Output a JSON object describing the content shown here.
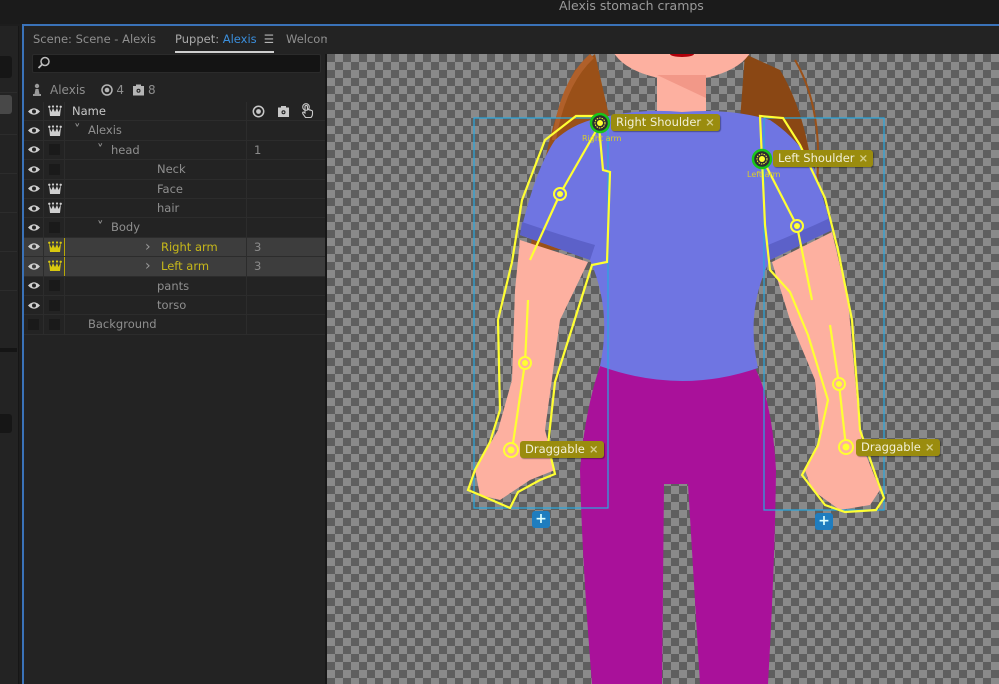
{
  "window": {
    "title": "Alexis stomach cramps"
  },
  "tabs": [
    {
      "label": "Scene: Scene - Alexis",
      "active": false
    },
    {
      "label_prefix": "Puppet: ",
      "label_accent": "Alexis",
      "active": true
    },
    {
      "label": "Welcome",
      "active": false
    }
  ],
  "search": {
    "value": "",
    "placeholder": ""
  },
  "puppet_info": {
    "name": "Alexis",
    "handles_count": "4",
    "behaviors_count": "8"
  },
  "table": {
    "header": {
      "name": "Name"
    },
    "rows": [
      {
        "name": "Alexis",
        "visible": true,
        "crown": true,
        "expanded": true,
        "indent": 0,
        "value": "",
        "selected": false
      },
      {
        "name": "head",
        "visible": true,
        "crown": false,
        "expanded": true,
        "indent": 1,
        "value": "1",
        "selected": false
      },
      {
        "name": "Neck",
        "visible": true,
        "crown": false,
        "indent": 2,
        "value": "",
        "selected": false
      },
      {
        "name": "Face",
        "visible": true,
        "crown": true,
        "indent": 2,
        "value": "",
        "selected": false
      },
      {
        "name": "hair",
        "visible": true,
        "crown": true,
        "indent": 2,
        "value": "",
        "selected": false
      },
      {
        "name": "Body",
        "visible": true,
        "crown": false,
        "expanded": true,
        "indent": 1,
        "value": "",
        "selected": false
      },
      {
        "name": "Right arm",
        "visible": true,
        "crown": true,
        "collapsed": true,
        "indent": 2,
        "value": "3",
        "selected": true
      },
      {
        "name": "Left arm",
        "visible": true,
        "crown": true,
        "collapsed": true,
        "indent": 2,
        "value": "3",
        "selected": true
      },
      {
        "name": "pants",
        "visible": true,
        "crown": false,
        "indent": 2,
        "value": "",
        "selected": false
      },
      {
        "name": "torso",
        "visible": true,
        "crown": false,
        "indent": 2,
        "value": "",
        "selected": false
      },
      {
        "name": "Background",
        "visible": false,
        "crown": false,
        "indent": 0,
        "value": "",
        "selected": false
      }
    ]
  },
  "canvas": {
    "tags": {
      "right_shoulder": "Right Shoulder",
      "left_shoulder": "Left Shoulder",
      "right_draggable": "Draggable",
      "left_draggable": "Draggable",
      "close_glyph": "×"
    },
    "labels": {
      "right_arm": "Right arm",
      "left_arm": "Left arm"
    },
    "add_glyph": "+"
  },
  "colors": {
    "accent_blue": "#3a72b8",
    "selection_yellow": "#ffff33",
    "tag_bg": "#9a8c0e",
    "shirt": "#6f75e2",
    "pants": "#a9119a",
    "skin": "#fdb0a0",
    "hair": "#9a5018"
  }
}
